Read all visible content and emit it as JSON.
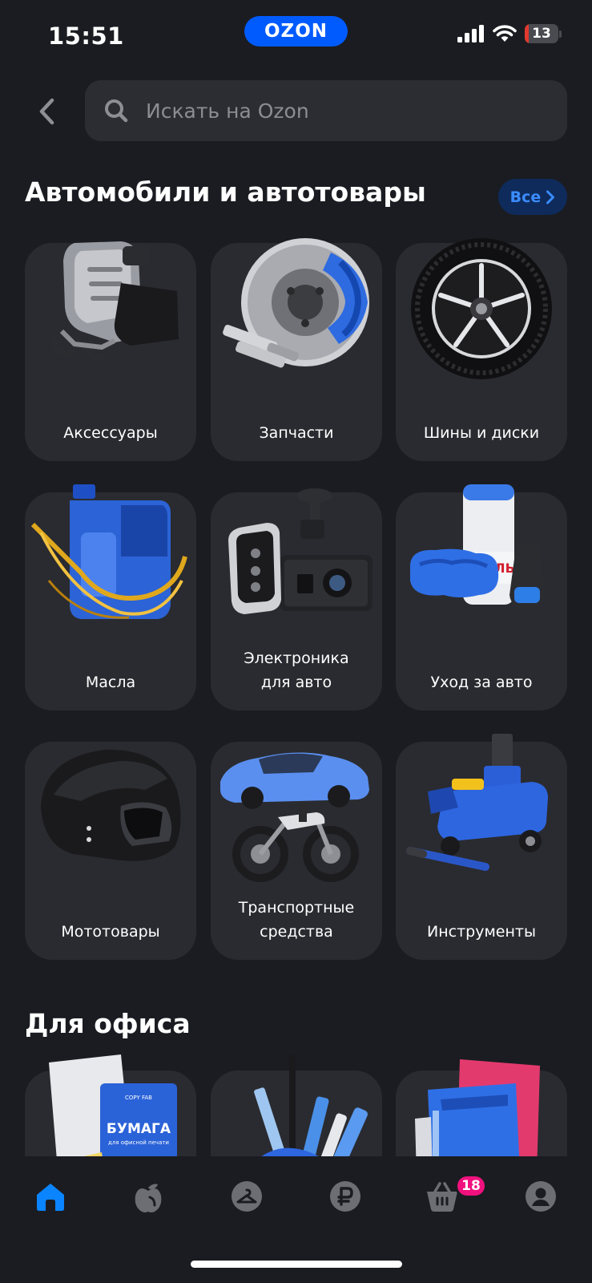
{
  "status_bar": {
    "time": "15:51",
    "battery": "13",
    "battery_level": 0.13
  },
  "app": {
    "logo": "OZON",
    "brand_color": "#005bff"
  },
  "search": {
    "placeholder": "Искать на Ozon"
  },
  "auto_section": {
    "title": "Автомобили и автотовары",
    "all_label": "Все",
    "categories": [
      {
        "label": "Аксессуары",
        "icon": "phone-holder-image"
      },
      {
        "label": "Запчасти",
        "icon": "brake-disc-image"
      },
      {
        "label": "Шины и диски",
        "icon": "wheel-image"
      },
      {
        "label": "Масла",
        "icon": "oil-canister-image"
      },
      {
        "label": "Электроника\nдля авто",
        "icon": "dashcam-image"
      },
      {
        "label": "Уход за авто",
        "icon": "car-care-image"
      },
      {
        "label": "Мототовары",
        "icon": "helmet-image"
      },
      {
        "label": "Транспортные\nсредства",
        "icon": "vehicles-image"
      },
      {
        "label": "Инструменты",
        "icon": "jack-image"
      }
    ]
  },
  "office_section": {
    "title": "Для офиса",
    "tiles": [
      {
        "icon": "paper-image",
        "print_brand": "COPY FAB",
        "print_text": "БУМАГА",
        "print_sub": "для офисной печати"
      },
      {
        "icon": "stationery-image"
      },
      {
        "icon": "folders-image"
      }
    ]
  },
  "bottom_nav": {
    "items": [
      {
        "name": "home",
        "icon": "home-icon",
        "active": true
      },
      {
        "name": "fresh",
        "icon": "apple-icon",
        "active": false
      },
      {
        "name": "fashion",
        "icon": "hanger-icon",
        "active": false
      },
      {
        "name": "finance",
        "icon": "ruble-icon",
        "active": false
      },
      {
        "name": "cart",
        "icon": "cart-icon",
        "active": false
      },
      {
        "name": "profile",
        "icon": "profile-icon",
        "active": false
      }
    ],
    "cart_count": "18",
    "active_color": "#0a84ff",
    "inactive_color": "#6d6e74"
  }
}
